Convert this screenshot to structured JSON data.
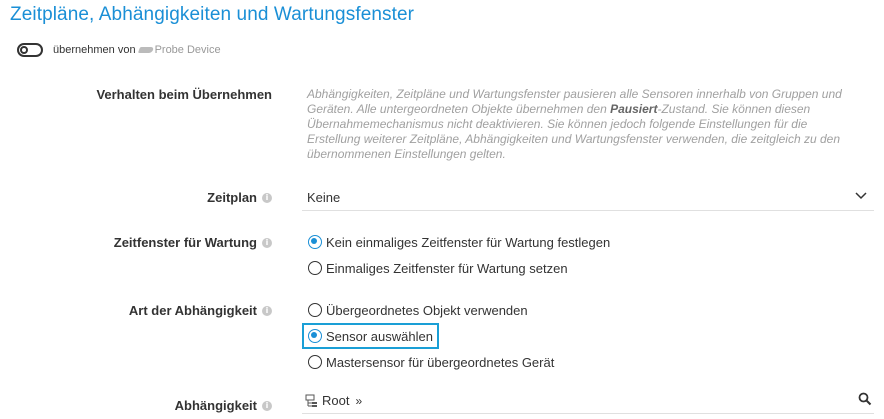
{
  "section": {
    "title": "Zeitpläne, Abhängigkeiten und Wartungsfenster"
  },
  "inherit": {
    "label": "übernehmen von",
    "source": "Probe Device",
    "enabled": false
  },
  "behavior": {
    "label": "Verhalten beim Übernehmen",
    "description_before": "Abhängigkeiten, Zeitpläne und Wartungsfenster pausieren alle Sensoren innerhalb von Gruppen und Geräten. Alle untergeordneten Objekte übernehmen den ",
    "description_bold": "Pausiert",
    "description_after": "-Zustand. Sie können diesen Übernahmemechanismus nicht deaktivieren. Sie können jedoch folgende Einstellungen für die Erstellung weiterer Zeitpläne, Abhängigkeiten und Wartungsfenster verwenden, die zeitgleich zu den übernommenen Einstellungen gelten."
  },
  "schedule": {
    "label": "Zeitplan",
    "value": "Keine"
  },
  "maintenance": {
    "label": "Zeitfenster für Wartung",
    "options": [
      {
        "label": "Kein einmaliges Zeitfenster für Wartung festlegen",
        "checked": true
      },
      {
        "label": "Einmaliges Zeitfenster für Wartung setzen",
        "checked": false
      }
    ]
  },
  "dependency_type": {
    "label": "Art der Abhängigkeit",
    "options": [
      {
        "label": "Übergeordnetes Objekt verwenden",
        "checked": false
      },
      {
        "label": "Sensor auswählen",
        "checked": true
      },
      {
        "label": "Mastersensor für übergeordnetes Gerät",
        "checked": false
      }
    ]
  },
  "dependency": {
    "label": "Abhängigkeit",
    "value": "Root",
    "arrow": "»"
  },
  "icons": {
    "info": "i",
    "toggle": "toggle-icon",
    "probe": "probe-device-icon",
    "chevron": "chevron-down-icon",
    "tree": "device-tree-icon",
    "search": "search-icon"
  },
  "colors": {
    "accent": "#1a8fd6",
    "muted_text": "#a0a0a0"
  }
}
